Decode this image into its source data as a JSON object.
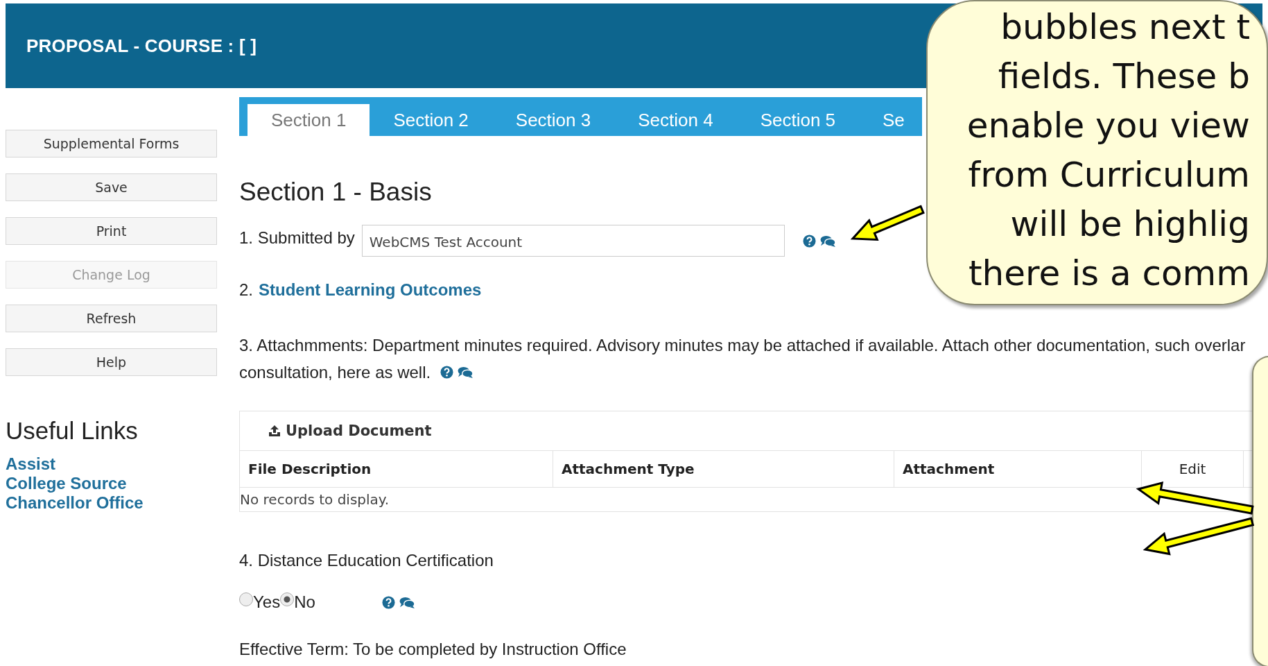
{
  "header": {
    "title": "PROPOSAL - COURSE : [ ]"
  },
  "sidebar": {
    "buttons": [
      {
        "label": "Supplemental Forms",
        "disabled": false
      },
      {
        "label": "Save",
        "disabled": false
      },
      {
        "label": "Print",
        "disabled": false
      },
      {
        "label": "Change Log",
        "disabled": true
      },
      {
        "label": "Refresh",
        "disabled": false
      },
      {
        "label": "Help",
        "disabled": false
      }
    ],
    "links_heading": "Useful Links",
    "links": [
      "Assist",
      "College Source",
      "Chancellor Office"
    ]
  },
  "tabs": [
    {
      "label": "Section 1",
      "selected": true
    },
    {
      "label": "Section 2",
      "selected": false
    },
    {
      "label": "Section 3",
      "selected": false
    },
    {
      "label": "Section 4",
      "selected": false
    },
    {
      "label": "Section 5",
      "selected": false
    },
    {
      "label": "Se",
      "selected": false
    }
  ],
  "section_title": "Section 1 - Basis",
  "submitted_by": {
    "label": "1. Submitted by",
    "value": "WebCMS Test Account"
  },
  "outcomes": {
    "number": "2.",
    "link": "Student Learning Outcomes"
  },
  "attachments": {
    "lines": [
      "3. Attachmments: Department minutes required. Advisory minutes may be attached if available. Attach other documentation, such overlar",
      "consultation, here as well."
    ],
    "upload_button": "Upload Document",
    "columns": [
      "File Description",
      "Attachment Type",
      "Attachment",
      "Edit"
    ],
    "empty_message": "No records to display."
  },
  "distance_education": {
    "label": "4. Distance Education Certification",
    "options": [
      {
        "label": "Yes",
        "selected": false
      },
      {
        "label": "No",
        "selected": true
      }
    ]
  },
  "effective_term": "Effective Term: To be completed by Instruction Office",
  "callout": {
    "lines": [
      "bubbles next t",
      "fields.  These b",
      "enable you view",
      "from Curriculum",
      "will be highlig",
      "there is a comm"
    ]
  }
}
